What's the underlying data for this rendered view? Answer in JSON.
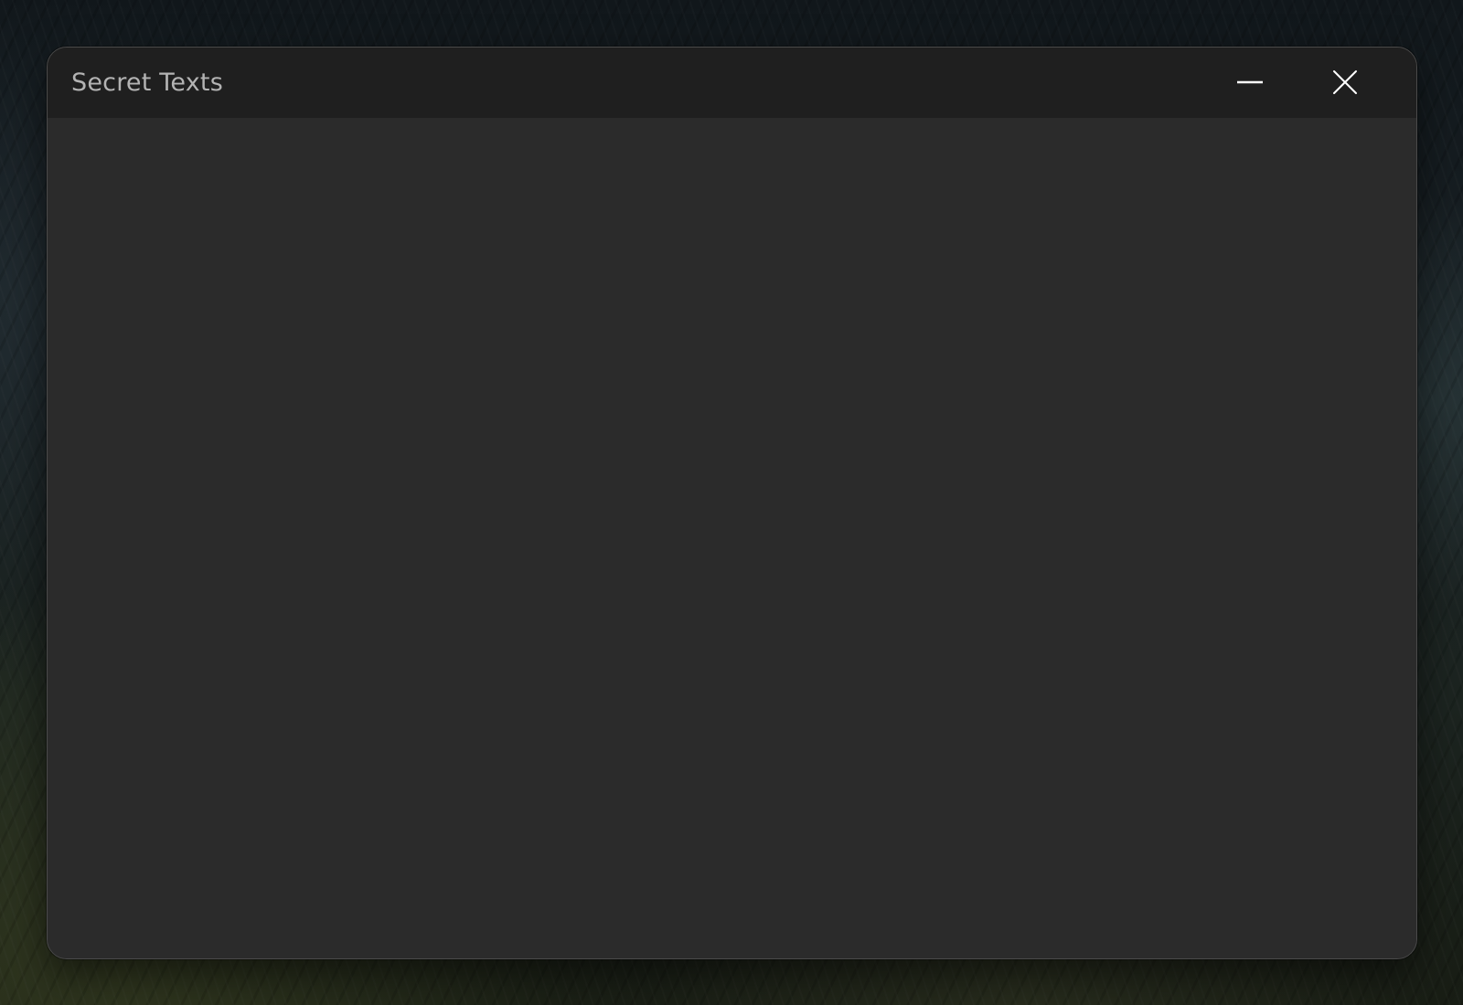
{
  "desktop": {
    "wallpaper": "dark-forest"
  },
  "window": {
    "title": "Secret Texts",
    "controls": {
      "minimize_icon": "minimize-icon",
      "close_icon": "close-icon"
    },
    "colors": {
      "title_bar": "#1f1f1f",
      "body": "#2b2b2b",
      "title_text": "#b3b3b3",
      "control_glyph": "#ffffff"
    }
  }
}
